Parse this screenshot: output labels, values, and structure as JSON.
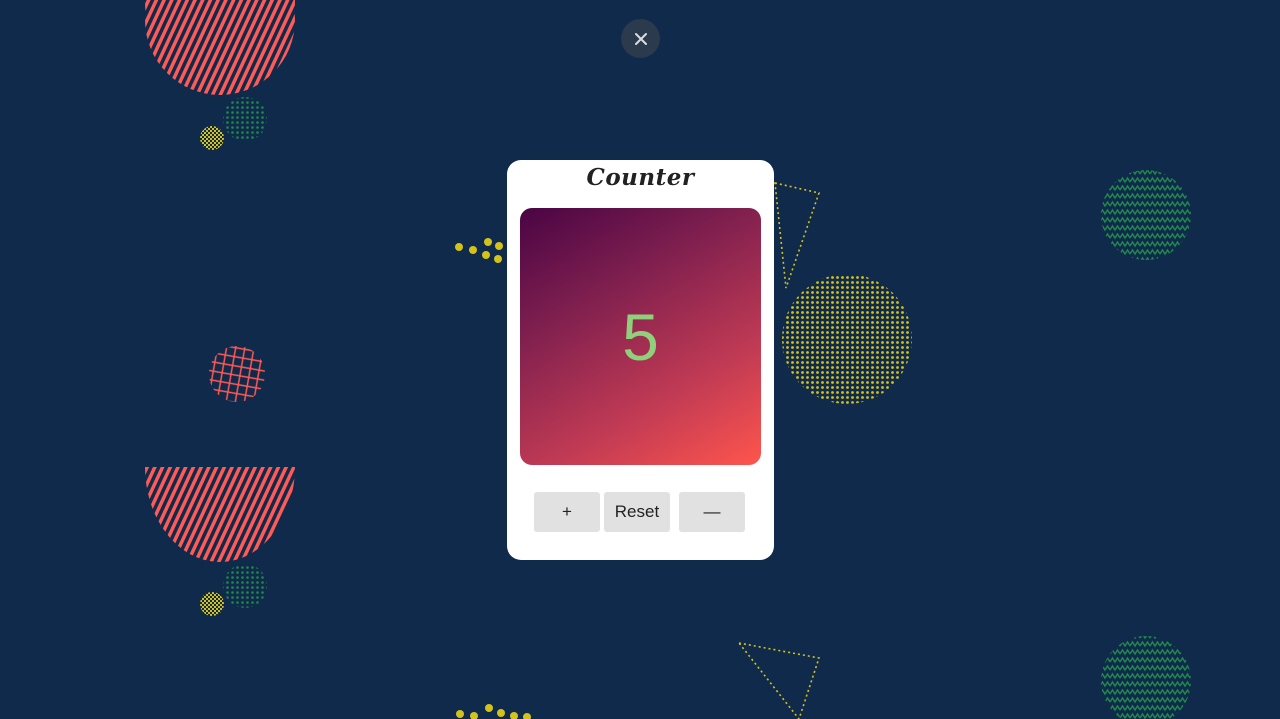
{
  "app": {
    "title": "Counter",
    "count": "5"
  },
  "controls": {
    "increment_label": "+",
    "reset_label": "Reset",
    "decrement_label": "—"
  },
  "colors": {
    "background": "#0f2a4a",
    "card": "#ffffff",
    "display_gradient_start": "#4a0444",
    "display_gradient_end": "#ff554c",
    "count_text": "#8fd17a",
    "button": "#e1e1e1",
    "decor_red": "#ff5a55",
    "decor_green": "#1f8a4c",
    "decor_yellow": "#d4c21a"
  },
  "icons": {
    "close": "close-icon"
  }
}
